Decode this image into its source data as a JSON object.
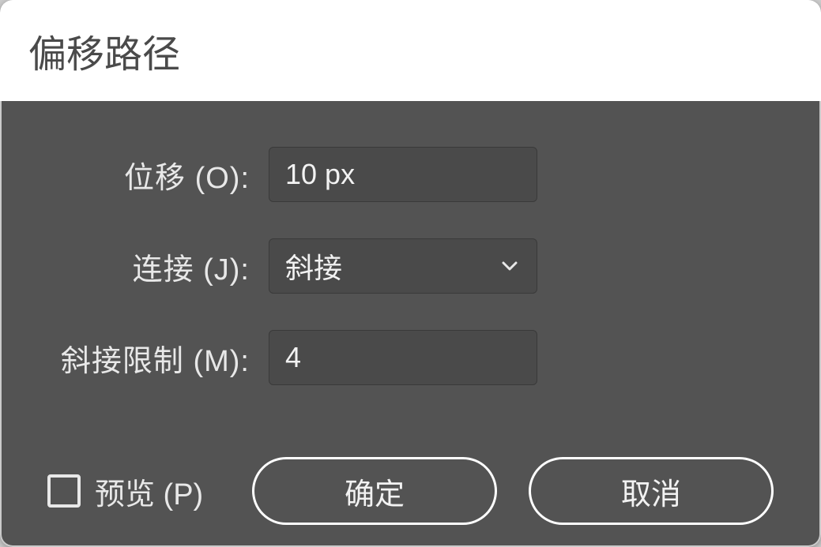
{
  "dialog": {
    "title": "偏移路径"
  },
  "fields": {
    "offset": {
      "label": "位移 (O):",
      "value": "10 px"
    },
    "joins": {
      "label": "连接 (J):",
      "value": "斜接"
    },
    "miter": {
      "label": "斜接限制 (M):",
      "value": "4"
    }
  },
  "footer": {
    "preview_label": "预览 (P)",
    "preview_checked": false,
    "ok_label": "确定",
    "cancel_label": "取消"
  }
}
